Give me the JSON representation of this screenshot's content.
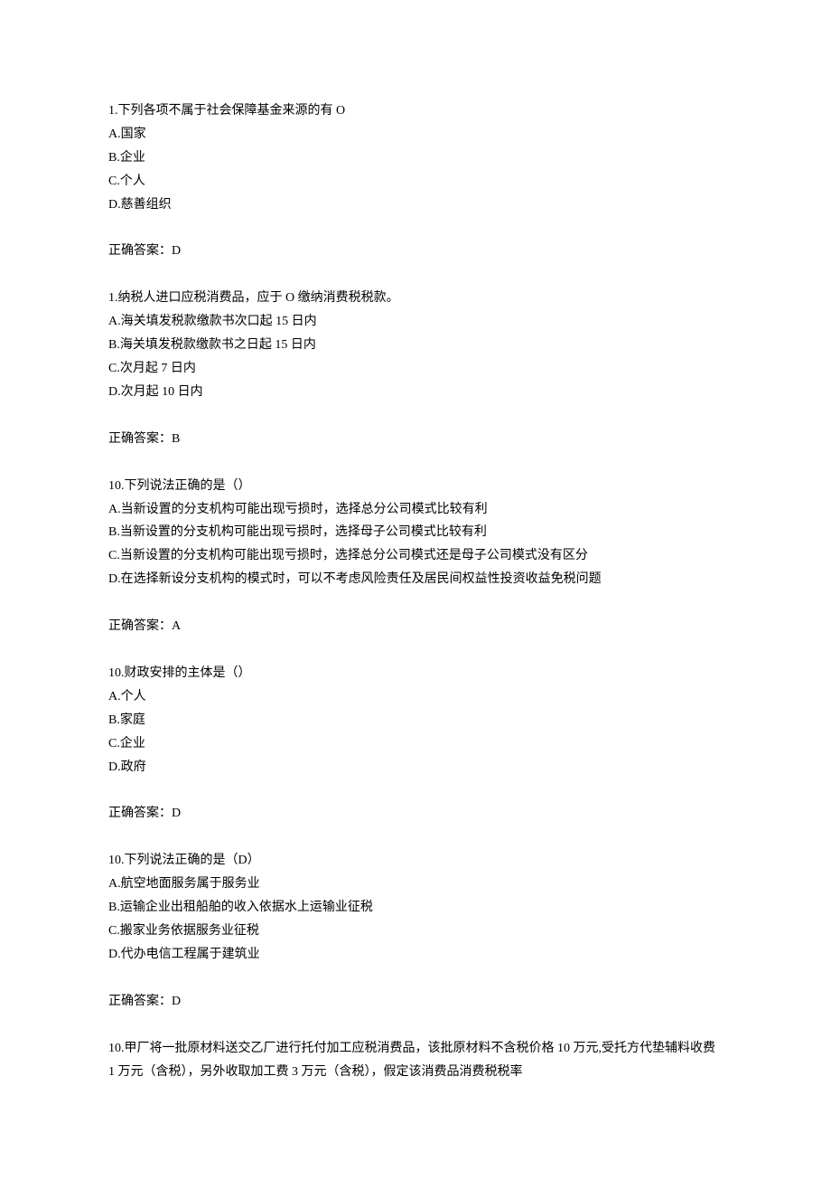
{
  "questions": [
    {
      "stem": "1.下列各项不属于社会保障基金来源的有 O",
      "options": [
        "A.国家",
        "B.企业",
        "C.个人",
        "D.慈善组织"
      ],
      "answer_label": "正确答案：D"
    },
    {
      "stem": "1.纳税人进口应税消费品，应于 O 缴纳消费税税款。",
      "options": [
        "A.海关填发税款缴款书次口起 15 日内",
        "B.海关填发税款缴款书之日起 15 日内",
        "C.次月起 7 日内",
        "D.次月起 10 日内"
      ],
      "answer_label": "正确答案：B"
    },
    {
      "stem": "10.下列说法正确的是（）",
      "options": [
        "A.当新设置的分支机构可能出现亏损时，选择总分公司模式比较有利",
        "B.当新设置的分支机构可能出现亏损时，选择母子公司模式比较有利",
        "C.当新设置的分支机构可能出现亏损时，选择总分公司模式还是母子公司模式没有区分",
        "D.在选择新设分支机构的模式时，可以不考虑风险责任及居民间权益性投资收益免税问题"
      ],
      "answer_label": "正确答案：A"
    },
    {
      "stem": "10.财政安排的主体是（）",
      "options": [
        "A.个人",
        "B.家庭",
        "C.企业",
        "D.政府"
      ],
      "answer_label": "正确答案：D"
    },
    {
      "stem": "10.下列说法正确的是（D）",
      "options": [
        "A.航空地面服务属于服务业",
        "B.运输企业出租船舶的收入依据水上运输业征税",
        "C.搬家业务依据服务业征税",
        "D.代办电信工程属于建筑业"
      ],
      "answer_label": "正确答案：D"
    },
    {
      "stem": "10.甲厂将一批原材料送交乙厂进行托付加工应税消费品，该批原材料不含税价格 10 万元,受托方代垫辅料收费 1 万元（含税），另外收取加工费 3 万元（含税），假定该消费品消费税税率",
      "options": [],
      "answer_label": ""
    }
  ]
}
